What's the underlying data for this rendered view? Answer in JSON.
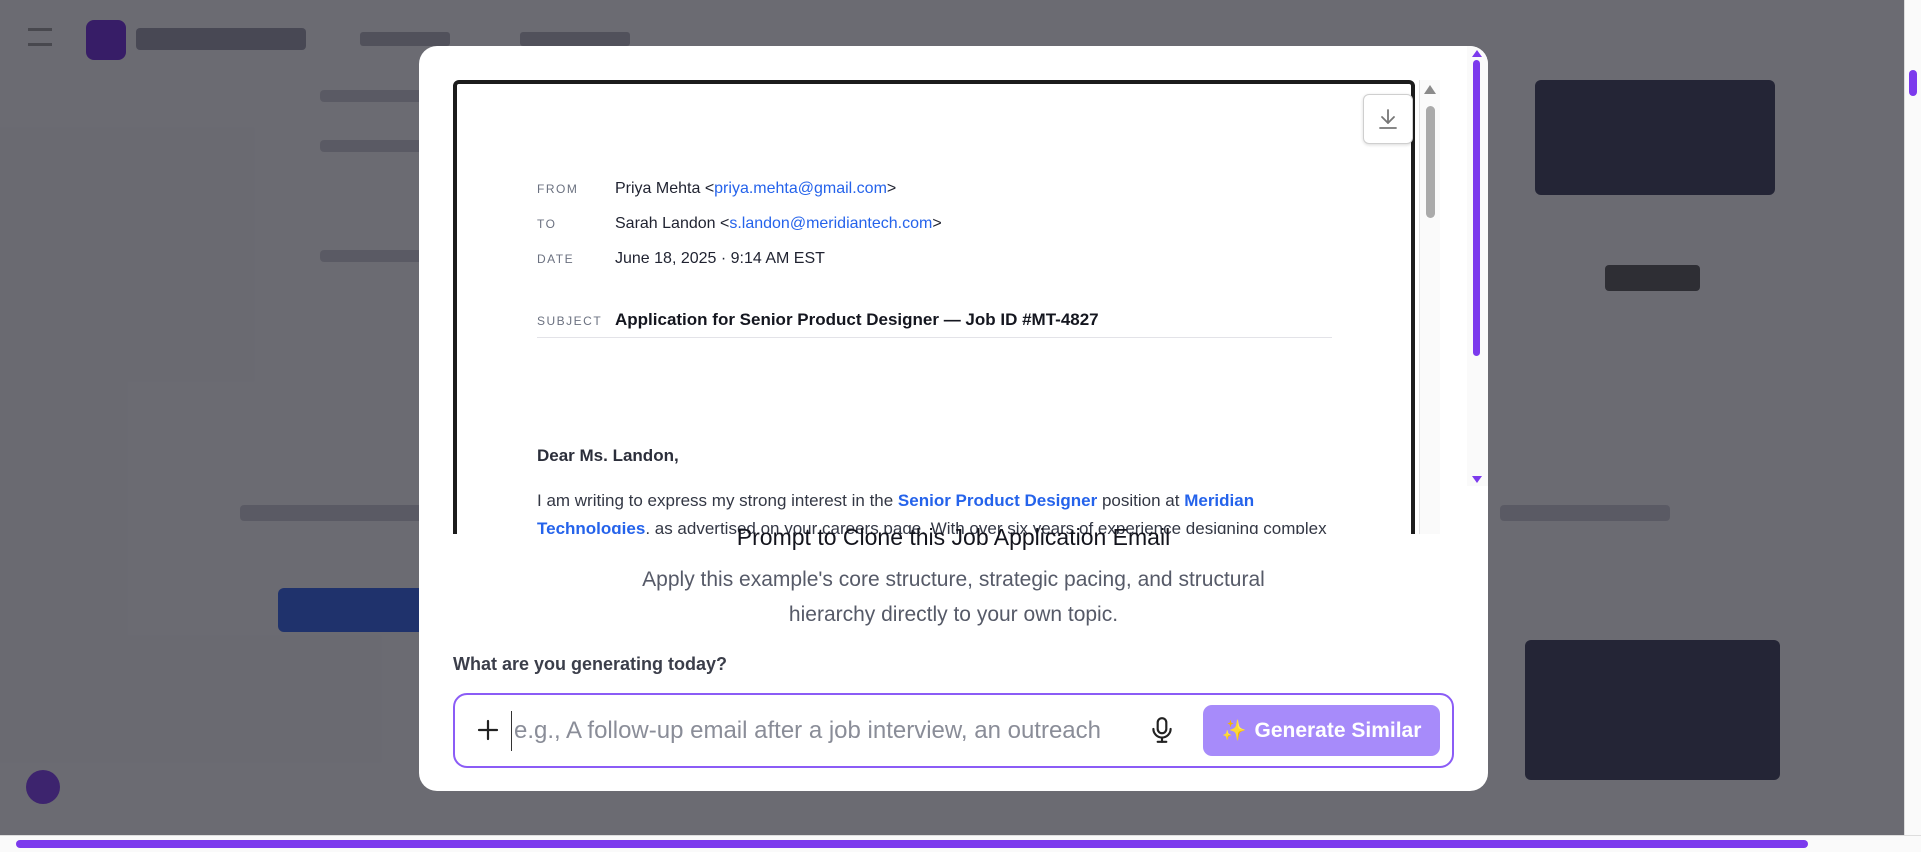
{
  "modal": {
    "email_preview": {
      "from_label": "FROM",
      "from_name": "Priya Mehta <",
      "from_email": "priya.mehta@gmail.com",
      "from_close": ">",
      "to_label": "TO",
      "to_name": "Sarah Landon <",
      "to_email": "s.landon@meridiantech.com",
      "to_close": ">",
      "date_label": "DATE",
      "date_value": "June 18, 2025 · 9:14 AM EST",
      "subject_label": "SUBJECT",
      "subject_value": "Application for Senior Product Designer — Job ID #MT-4827",
      "greeting": "Dear Ms. Landon,",
      "body_1a": "I am writing to express my strong interest in the ",
      "body_role": "Senior Product Designer",
      "body_1b": " position at ",
      "body_company": "Meridian Technologies",
      "body_1c": ", as advertised on your careers page. With over six years of experience designing complex"
    },
    "title": "Prompt to Clone this Job Application Email",
    "subtitle": "Apply this example's core structure, strategic pacing, and structural hierarchy directly to your own topic.",
    "question": "What are you generating today?",
    "input_placeholder": "e.g., A follow-up email after a job interview, an outreach",
    "generate_label": "Generate Similar",
    "icons": {
      "download": "download-icon",
      "plus": "plus-icon",
      "mic": "microphone-icon",
      "sparkle": "sparkle-icon"
    }
  },
  "colors": {
    "accent": "#7c3aed",
    "button": "#a78bfa",
    "link": "#2563eb"
  }
}
